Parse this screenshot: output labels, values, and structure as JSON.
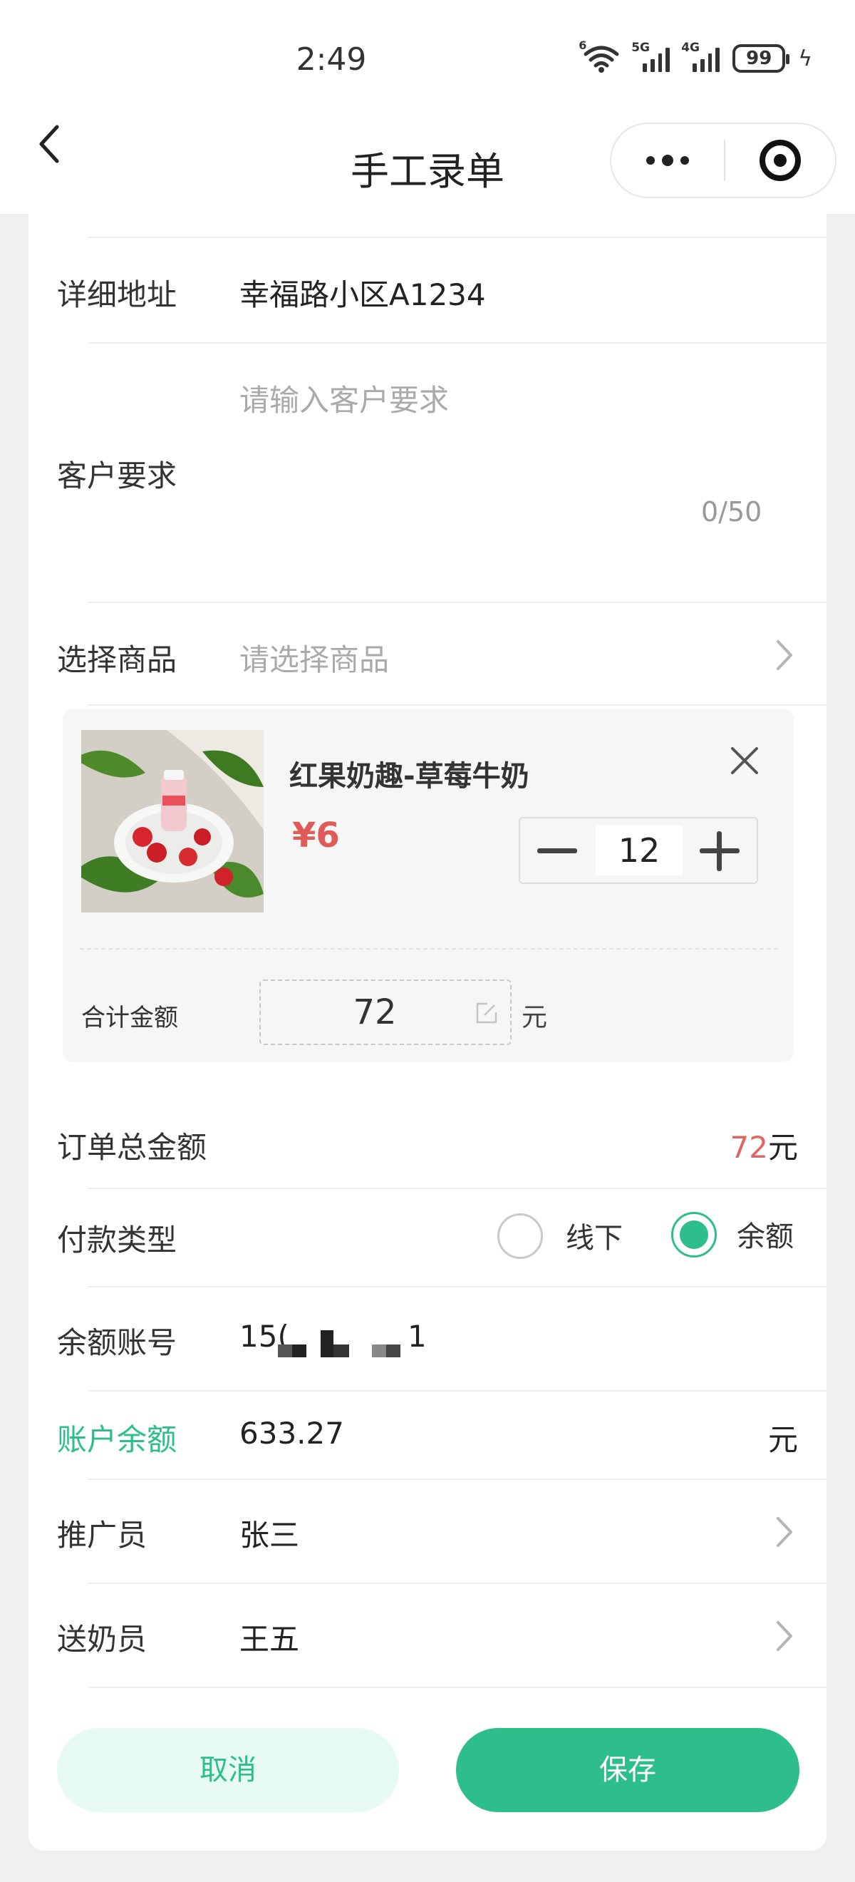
{
  "status_bar": {
    "time": "2:49",
    "wifi_net": "6",
    "sim1_net": "5G",
    "sim2_net": "4G",
    "battery": "99"
  },
  "nav": {
    "title": "手工录单"
  },
  "form": {
    "address": {
      "label": "详细地址",
      "value": "幸福路小区A1234"
    },
    "requirement": {
      "label": "客户要求",
      "placeholder": "请输入客户要求",
      "counter": "0/50"
    },
    "goods": {
      "label": "选择商品",
      "placeholder": "请选择商品"
    },
    "product": {
      "name": "红果奶趣-草莓牛奶",
      "price": "¥6",
      "quantity": "12",
      "subtotal_label": "合计金额",
      "subtotal": "72",
      "subtotal_unit": "元"
    },
    "order_total": {
      "label": "订单总金额",
      "value": "72",
      "unit": "元"
    },
    "payment": {
      "label": "付款类型",
      "options": [
        "线下",
        "余额"
      ],
      "selected": "余额"
    },
    "balance_account": {
      "label": "余额账号",
      "value_start": "15(",
      "value_end": "1"
    },
    "account_balance": {
      "label": "账户余额",
      "value": "633.27",
      "unit": "元"
    },
    "promoter": {
      "label": "推广员",
      "value": "张三"
    },
    "deliverer": {
      "label": "送奶员",
      "value": "王五"
    }
  },
  "actions": {
    "cancel": "取消",
    "save": "保存"
  },
  "colors": {
    "accent": "#2dbe8c",
    "price_red": "#e05a5a"
  }
}
